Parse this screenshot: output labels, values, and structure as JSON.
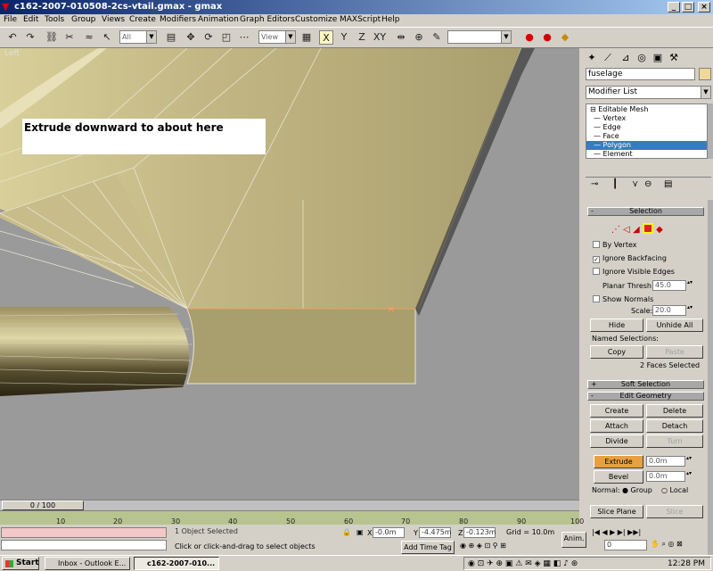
{
  "window": {
    "title": "c162-2007-010508-2cs-vtail.gmax - gmax",
    "minimize": "_",
    "maximize": "□",
    "close": "×"
  },
  "menu": [
    "File",
    "Edit",
    "Tools",
    "Group",
    "Views",
    "Create",
    "Modifiers",
    "Animation",
    "Graph Editors",
    "Customize",
    "MAXScript",
    "Help"
  ],
  "toolbar": {
    "selection_filter": "All",
    "coord_system": "View",
    "named_selection": ""
  },
  "viewport": {
    "label": "Left",
    "annotation": "Extrude downward to about here"
  },
  "timeline": {
    "slider": "0 / 100",
    "ticks": [
      "10",
      "20",
      "30",
      "40",
      "50",
      "60",
      "70",
      "80",
      "90",
      "100"
    ]
  },
  "status": {
    "selected": "1 Object Selected",
    "prompt": "Click or click-and-drag to select objects",
    "x_label": "X",
    "x_value": "-0.0m",
    "y_label": "Y",
    "y_value": "-4.475m",
    "z_label": "Z",
    "z_value": "-0.123m",
    "grid": "Grid = 10.0m",
    "add_time_tag": "Add Time Tag",
    "anim": "Anim.",
    "frame": "0"
  },
  "panel": {
    "object_name": "fuselage",
    "object_color": "#f0d89a",
    "modifier_list": "Modifier List",
    "stack": [
      "Editable Mesh",
      "Vertex",
      "Edge",
      "Face",
      "Polygon",
      "Element"
    ],
    "stack_selected": "Polygon",
    "selection": {
      "title": "Selection",
      "by_vertex": "By Vertex",
      "by_vertex_checked": false,
      "ignore_backfacing": "Ignore Backfacing",
      "ignore_backfacing_checked": true,
      "ignore_visible_edges": "Ignore Visible Edges",
      "ignore_visible_edges_checked": false,
      "planar_thresh_label": "Planar Thresh:",
      "planar_thresh_value": "45.0",
      "show_normals": "Show Normals",
      "show_normals_checked": false,
      "scale_label": "Scale:",
      "scale_value": "20.0",
      "hide": "Hide",
      "unhide_all": "Unhide All",
      "named_selections": "Named Selections:",
      "copy": "Copy",
      "paste": "Paste",
      "faces_selected": "2 Faces Selected"
    },
    "soft_selection": "Soft Selection",
    "edit_geometry": {
      "title": "Edit Geometry",
      "create": "Create",
      "delete": "Delete",
      "attach": "Attach",
      "detach": "Detach",
      "divide": "Divide",
      "turn": "Turn",
      "extrude": "Extrude",
      "extrude_value": "0.0m",
      "bevel": "Bevel",
      "bevel_value": "0.0m",
      "normal_label": "Normal:",
      "group": "Group",
      "local": "Local",
      "slice_plane": "Slice Plane",
      "slice": "Slice"
    }
  },
  "taskbar": {
    "start": "Start",
    "tasks": [
      "Inbox - Outlook E...",
      "c162-2007-010..."
    ],
    "clock": "12:28 PM"
  },
  "colors": {
    "mesh_face": "#a99e6e",
    "mesh_light": "#d8d0a0",
    "mesh_dark": "#3a3420",
    "selection_highlight": "#3a7abf",
    "extrude_active": "#e8a040"
  }
}
